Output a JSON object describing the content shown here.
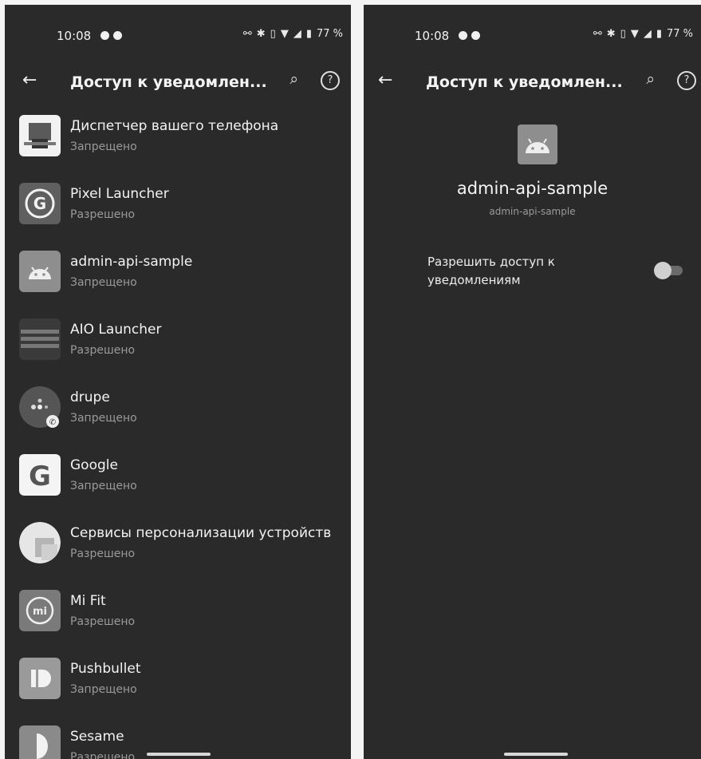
{
  "left": {
    "status_bar": {
      "time": "10:08",
      "battery": "77 %"
    },
    "title": "Доступ к уведомлен...",
    "apps": [
      {
        "name": "Диспетчер вашего телефона",
        "status": "Запрещено",
        "icon": "phone-link-icon"
      },
      {
        "name": "Pixel Launcher",
        "status": "Разрешено",
        "icon": "google-g-icon"
      },
      {
        "name": "admin-api-sample",
        "status": "Запрещено",
        "icon": "android-icon"
      },
      {
        "name": "AIO Launcher",
        "status": "Разрешено",
        "icon": "aio-launcher-icon"
      },
      {
        "name": "drupe",
        "status": "Запрещено",
        "icon": "drupe-icon"
      },
      {
        "name": "Google",
        "status": "Запрещено",
        "icon": "google-icon"
      },
      {
        "name": "Сервисы персонализации устройств",
        "status": "Разрешено",
        "icon": "personalization-icon"
      },
      {
        "name": "Mi Fit",
        "status": "Разрешено",
        "icon": "mi-fit-icon"
      },
      {
        "name": "Pushbullet",
        "status": "Запрещено",
        "icon": "pushbullet-icon"
      },
      {
        "name": "Sesame",
        "status": "Разрешено",
        "icon": "sesame-icon"
      }
    ]
  },
  "right": {
    "status_bar": {
      "time": "10:08",
      "battery": "77 %"
    },
    "title": "Доступ к уведомлен...",
    "app_name": "admin-api-sample",
    "package": "admin-api-sample",
    "permission_label": "Разрешить доступ к уведомлениям",
    "permission_enabled": false
  }
}
